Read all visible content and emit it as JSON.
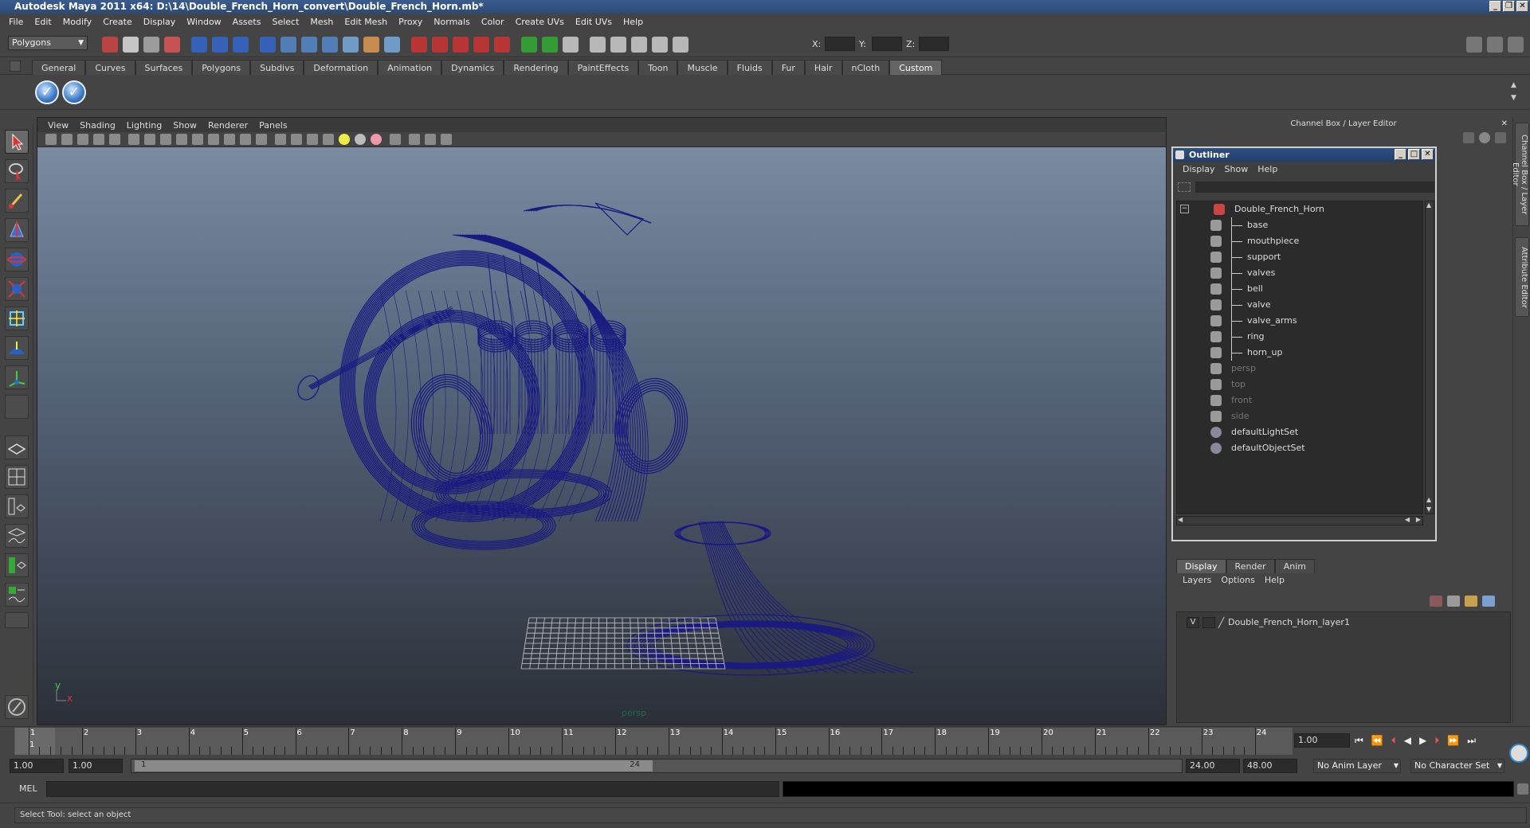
{
  "window": {
    "title": "Autodesk Maya 2011 x64: D:\\14\\Double_French_Horn_convert\\Double_French_Horn.mb*"
  },
  "menubar": [
    "File",
    "Edit",
    "Modify",
    "Create",
    "Display",
    "Window",
    "Assets",
    "Select",
    "Mesh",
    "Edit Mesh",
    "Proxy",
    "Normals",
    "Color",
    "Create UVs",
    "Edit UVs",
    "Help"
  ],
  "status_line": {
    "mode": "Polygons",
    "x_label": "X:",
    "y_label": "Y:",
    "z_label": "Z:"
  },
  "shelf_tabs": [
    "General",
    "Curves",
    "Surfaces",
    "Polygons",
    "Subdivs",
    "Deformation",
    "Animation",
    "Dynamics",
    "Rendering",
    "PaintEffects",
    "Toon",
    "Muscle",
    "Fluids",
    "Fur",
    "Hair",
    "nCloth",
    "Custom"
  ],
  "shelf_tab_active": "Custom",
  "viewport": {
    "menu": [
      "View",
      "Shading",
      "Lighting",
      "Show",
      "Renderer",
      "Panels"
    ],
    "camera_label": "persp",
    "axis_y": "y",
    "axis_x": "x",
    "wire_color": "#1a1a80"
  },
  "channel_box": {
    "header": "Channel Box / Layer Editor"
  },
  "right_tabs": {
    "channel": "Channel Box / Layer Editor",
    "attribute": "Attribute Editor"
  },
  "outliner": {
    "title": "Outliner",
    "menu": [
      "Display",
      "Show",
      "Help"
    ],
    "items": [
      {
        "name": "Double_French_Horn",
        "level": 0
      },
      {
        "name": "base",
        "level": 1
      },
      {
        "name": "mouthpiece",
        "level": 1
      },
      {
        "name": "support",
        "level": 1
      },
      {
        "name": "valves",
        "level": 1
      },
      {
        "name": "bell",
        "level": 1
      },
      {
        "name": "valve",
        "level": 1
      },
      {
        "name": "valve_arms",
        "level": 1
      },
      {
        "name": "ring",
        "level": 1
      },
      {
        "name": "horn_up",
        "level": 1
      },
      {
        "name": "persp",
        "level": 0,
        "dim": true
      },
      {
        "name": "top",
        "level": 0,
        "dim": true
      },
      {
        "name": "front",
        "level": 0,
        "dim": true
      },
      {
        "name": "side",
        "level": 0,
        "dim": true
      },
      {
        "name": "defaultLightSet",
        "level": 0
      },
      {
        "name": "defaultObjectSet",
        "level": 0
      }
    ]
  },
  "layer_editor": {
    "tabs": [
      "Display",
      "Render",
      "Anim"
    ],
    "active_tab": "Display",
    "menu": [
      "Layers",
      "Options",
      "Help"
    ],
    "layer": {
      "visible": "V",
      "name": "Double_French_Horn_layer1"
    }
  },
  "timeline": {
    "frames": [
      "1",
      "2",
      "3",
      "4",
      "5",
      "6",
      "7",
      "8",
      "9",
      "10",
      "11",
      "12",
      "13",
      "14",
      "15",
      "16",
      "17",
      "18",
      "19",
      "20",
      "21",
      "22",
      "23",
      "24"
    ],
    "current_frame_marker": "1",
    "current_time": "1.00"
  },
  "range_slider": {
    "start_time": "1.00",
    "playback_start": "1.00",
    "range_start_label": "1",
    "range_end_label": "24",
    "playback_end": "24.00",
    "end_time": "48.00",
    "anim_layer": "No Anim Layer",
    "character_set": "No Character Set"
  },
  "command_line": {
    "label": "MEL"
  },
  "help_line": {
    "text": "Select Tool: select an object"
  }
}
